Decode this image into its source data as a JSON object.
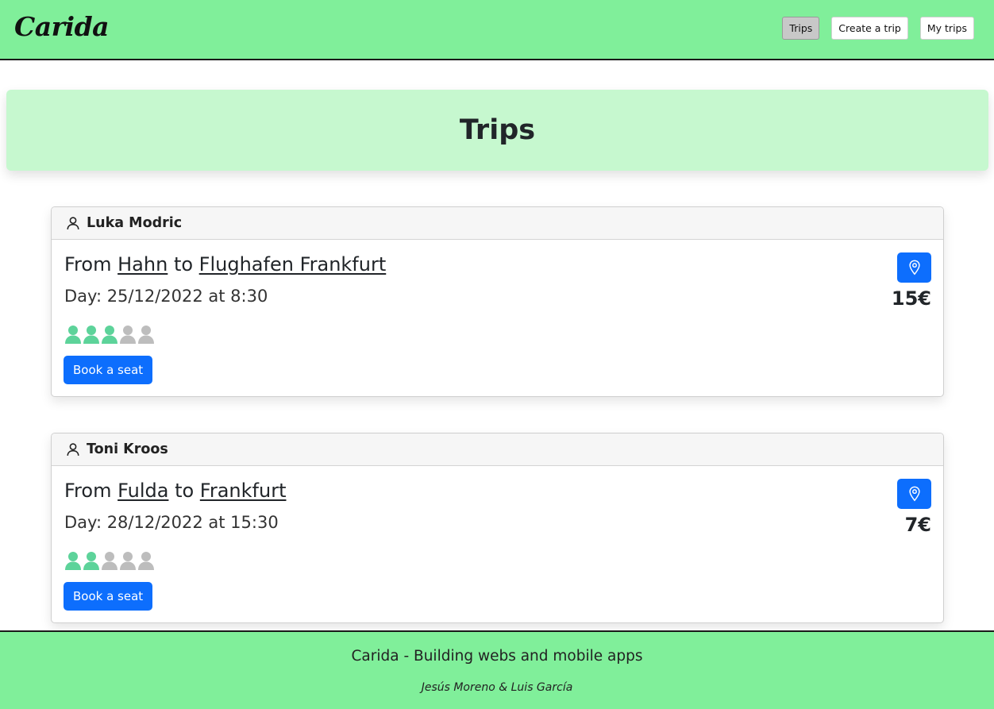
{
  "app": {
    "brand": "Carida"
  },
  "nav": {
    "items": [
      {
        "label": "Trips",
        "active": true
      },
      {
        "label": "Create a trip",
        "active": false
      },
      {
        "label": "My trips",
        "active": false
      }
    ]
  },
  "banner": {
    "title": "Trips"
  },
  "colors": {
    "header_bg": "#80ef9a",
    "banner_bg": "#c6f8cf",
    "primary": "#0d6efd",
    "seat_taken": "#5dd39a",
    "seat_free": "#bdbdbd"
  },
  "trips": [
    {
      "driver": "Luka Modric",
      "from_word": "From",
      "from": "Hahn",
      "to_word": "to",
      "to": "Flughafen Frankfurt",
      "day": "Day: 25/12/2022 at 8:30",
      "seats_taken": 3,
      "seats_total": 5,
      "price": "15€",
      "book_label": "Book a seat"
    },
    {
      "driver": "Toni Kroos",
      "from_word": "From",
      "from": "Fulda",
      "to_word": "to",
      "to": "Frankfurt",
      "day": "Day: 28/12/2022 at 15:30",
      "seats_taken": 2,
      "seats_total": 5,
      "price": "7€",
      "book_label": "Book a seat"
    }
  ],
  "footer": {
    "tagline": "Carida - Building webs and mobile apps",
    "authors": "Jesús Moreno & Luis García"
  }
}
